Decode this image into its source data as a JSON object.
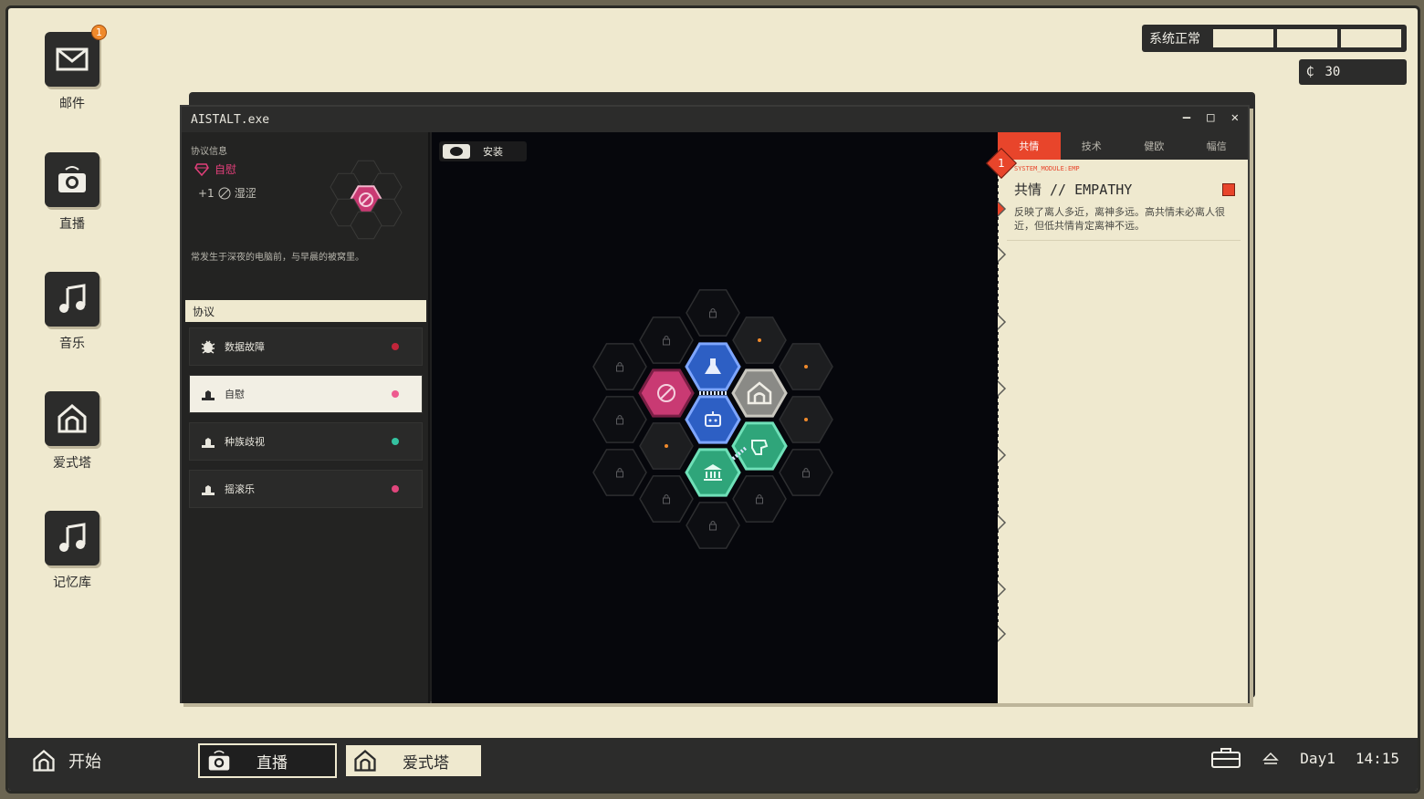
{
  "desktop": {
    "icons": [
      {
        "label": "邮件",
        "icon": "mail-icon",
        "badge": "1"
      },
      {
        "label": "直播",
        "icon": "camera-icon"
      },
      {
        "label": "音乐",
        "icon": "music-note-icon"
      },
      {
        "label": "爱式塔",
        "icon": "tower-icon"
      },
      {
        "label": "记忆库",
        "icon": "music-note-icon"
      }
    ],
    "status": {
      "text": "系统正常"
    },
    "credits": {
      "value": "30"
    }
  },
  "window": {
    "title": "AISTALT.exe",
    "left": {
      "info_header": "协议信息",
      "protocol_name": "自慰",
      "bonus": "+1",
      "bonus_label": "湿涩",
      "description": "常发生于深夜的电脑前，与早晨的被窝里。",
      "section_header": "协议",
      "items": [
        {
          "label": "数据故障",
          "icon": "bug-icon",
          "dot_color": "#c2253a",
          "selected": false
        },
        {
          "label": "自慰",
          "icon": "hand-icon",
          "dot_color": "#ee5b8f",
          "selected": true
        },
        {
          "label": "种族歧视",
          "icon": "hand-icon",
          "dot_color": "#34c2a0",
          "selected": false
        },
        {
          "label": "摇滚乐",
          "icon": "hand-icon",
          "dot_color": "#e0467c",
          "selected": false
        }
      ]
    },
    "center": {
      "install_label": "安装"
    },
    "right": {
      "tabs": [
        "共情",
        "技术",
        "健欧",
        "幅信"
      ],
      "active_tab": 0,
      "marker_number": "1",
      "module_id": "SYSTEM_MODULE:EMP",
      "title": "共情 // EMPATHY",
      "description": "反映了离人多近，离神多远。高共情未必离人很近，但低共情肯定离神不远。"
    }
  },
  "taskbar": {
    "start_label": "开始",
    "tasks": [
      {
        "label": "直播",
        "icon": "camera-icon",
        "active": false
      },
      {
        "label": "爱式塔",
        "icon": "tower-icon",
        "active": true
      }
    ],
    "day": "Day1",
    "time": "14:15"
  },
  "colors": {
    "accent_red": "#e8452b",
    "magenta": "#c93a73",
    "blue_hex": "#2d5fc4",
    "teal_hex": "#2fa57a",
    "grey_hex": "#8a8a86",
    "desk_bg": "#efe9cf"
  }
}
